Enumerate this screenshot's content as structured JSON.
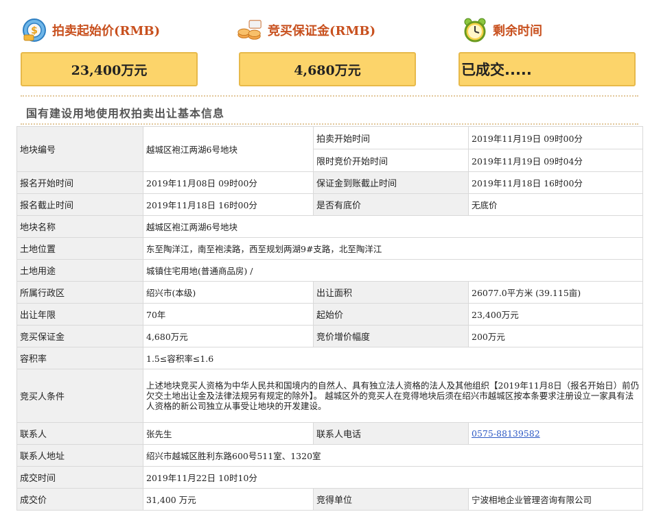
{
  "header": {
    "start_price_label": "拍卖起始价(RMB)",
    "start_price_value": "23,400万元",
    "deposit_label": "竞买保证金(RMB)",
    "deposit_value": "4,680万元",
    "remaining_label": "剩余时间",
    "remaining_value": "已成交....."
  },
  "icons": {
    "start_price": "price-money-icon",
    "deposit": "deposit-coins-icon",
    "remaining": "alarm-clock-icon"
  },
  "section_title": "国有建设用地使用权拍卖出让基本信息",
  "table": {
    "parcel_no_label": "地块编号",
    "parcel_no": "越城区袍江两湖6号地块",
    "auction_start_label": "拍卖开始时间",
    "auction_start": "2019年11月19日 09时00分",
    "limit_bid_start_label": "限时竞价开始时间",
    "limit_bid_start": "2019年11月19日 09时04分",
    "reg_start_label": "报名开始时间",
    "reg_start": "2019年11月08日 09时00分",
    "deposit_deadline_label": "保证金到账截止时间",
    "deposit_deadline": "2019年11月18日 16时00分",
    "reg_end_label": "报名截止时间",
    "reg_end": "2019年11月18日 16时00分",
    "reserve_label": "是否有底价",
    "reserve": "无底价",
    "parcel_name_label": "地块名称",
    "parcel_name": "越城区袍江两湖6号地块",
    "location_label": "土地位置",
    "location": "东至陶洋江，南至袍渎路，西至规划两湖9#支路，北至陶洋江",
    "usage_label": "土地用途",
    "usage": "城镇住宅用地(普通商品房) /",
    "district_label": "所属行政区",
    "district": "绍兴市(本级)",
    "area_label": "出让面积",
    "area": "26077.0平方米 (39.115亩)",
    "term_label": "出让年限",
    "term": "70年",
    "start_price_label": "起始价",
    "start_price": "23,400万元",
    "deposit_label": "竞买保证金",
    "deposit": "4,680万元",
    "increment_label": "竞价增价幅度",
    "increment": "200万元",
    "far_label": "容积率",
    "far": "1.5≤容积率≤1.6",
    "bidder_cond_label": "竞买人条件",
    "bidder_cond": "上述地块竞买人资格为中华人民共和国境内的自然人、具有独立法人资格的法人及其他组织【2019年11月8日（报名开始日）前仍欠交土地出让金及法律法规另有规定的除外】。 越城区外的竞买人在竞得地块后须在绍兴市越城区按本条要求注册设立一家具有法人资格的新公司独立从事受让地块的开发建设。",
    "contact_label": "联系人",
    "contact": "张先生",
    "phone_label": "联系人电话",
    "phone": "0575-88139582",
    "address_label": "联系人地址",
    "address": "绍兴市越城区胜利东路600号511室、1320室",
    "deal_time_label": "成交时间",
    "deal_time": "2019年11月22日 10时10分",
    "deal_price_label": "成交价",
    "deal_price": "31,400 万元",
    "winner_label": "竞得单位",
    "winner": "宁波相地企业管理咨询有限公司"
  },
  "colors": {
    "badge_fill": "#fcd46a",
    "badge_border": "#e7b94a",
    "label_orange": "#c8501e",
    "link_blue": "#2b58c4"
  }
}
